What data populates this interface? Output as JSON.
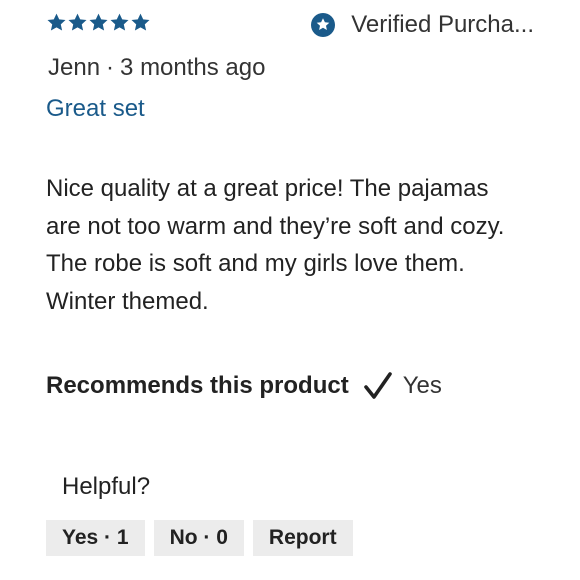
{
  "review": {
    "rating": 5,
    "rating_max": 5,
    "verified_label": "Verified Purcha...",
    "author": "Jenn",
    "separator": "·",
    "date": "3 months ago",
    "title": "Great set",
    "body": "Nice quality at a great price! The pajamas are not too warm and they’re soft and cozy. The robe is soft and my girls love them. Winter themed.",
    "recommend_label": "Recommends this product",
    "recommend_value": "Yes",
    "helpful_label": "Helpful?",
    "buttons": {
      "yes_label": "Yes · 1",
      "no_label": "No · 0",
      "report_label": "Report"
    }
  },
  "colors": {
    "star": "#1a5a8a",
    "verified_icon": "#1a5a8a",
    "title": "#1a5a8a",
    "button_bg": "#ececec"
  },
  "icons": {
    "star": "star-icon",
    "verified": "verified-badge-icon",
    "check": "checkmark-icon"
  }
}
